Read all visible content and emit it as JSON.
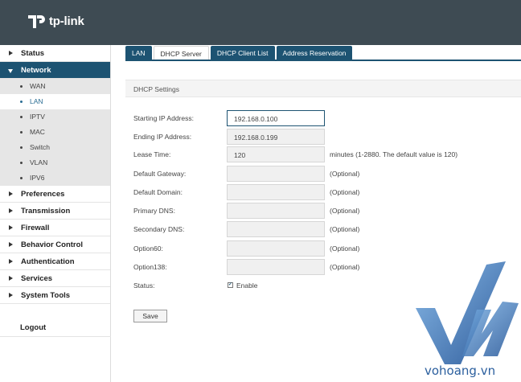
{
  "brand": {
    "name": "tp-link"
  },
  "sidebar": {
    "top_items": [
      {
        "label": "Status"
      },
      {
        "label": "Network"
      }
    ],
    "network_sub": [
      {
        "label": "WAN"
      },
      {
        "label": "LAN"
      },
      {
        "label": "IPTV"
      },
      {
        "label": "MAC"
      },
      {
        "label": "Switch"
      },
      {
        "label": "VLAN"
      },
      {
        "label": "IPV6"
      }
    ],
    "bottom_items": [
      {
        "label": "Preferences"
      },
      {
        "label": "Transmission"
      },
      {
        "label": "Firewall"
      },
      {
        "label": "Behavior Control"
      },
      {
        "label": "Authentication"
      },
      {
        "label": "Services"
      },
      {
        "label": "System Tools"
      }
    ],
    "logout": "Logout",
    "active_item": "Network",
    "selected_sub": "LAN"
  },
  "tabs": [
    {
      "label": "LAN"
    },
    {
      "label": "DHCP Server"
    },
    {
      "label": "DHCP Client List"
    },
    {
      "label": "Address Reservation"
    }
  ],
  "active_tab": "DHCP Server",
  "section_title": "DHCP Settings",
  "form": {
    "start_ip": {
      "label": "Starting IP Address:",
      "value": "192.168.0.100"
    },
    "end_ip": {
      "label": "Ending IP Address:",
      "value": "192.168.0.199"
    },
    "lease": {
      "label": "Lease Time:",
      "value": "120",
      "hint": "minutes (1-2880. The default value is 120)"
    },
    "gateway": {
      "label": "Default Gateway:",
      "value": "",
      "hint": "(Optional)"
    },
    "domain": {
      "label": "Default Domain:",
      "value": "",
      "hint": "(Optional)"
    },
    "pdns": {
      "label": "Primary DNS:",
      "value": "",
      "hint": "(Optional)"
    },
    "sdns": {
      "label": "Secondary DNS:",
      "value": "",
      "hint": "(Optional)"
    },
    "opt60": {
      "label": "Option60:",
      "value": "",
      "hint": "(Optional)"
    },
    "opt138": {
      "label": "Option138:",
      "value": "",
      "hint": "(Optional)"
    },
    "status": {
      "label": "Status:",
      "option": "Enable",
      "checked": true
    }
  },
  "save_label": "Save",
  "watermark": {
    "text": "vohoang.vn"
  },
  "colors": {
    "topbar": "#3e4b53",
    "accent": "#1d5372",
    "link": "#2a6d93",
    "watermark": "#2b5f9e"
  }
}
